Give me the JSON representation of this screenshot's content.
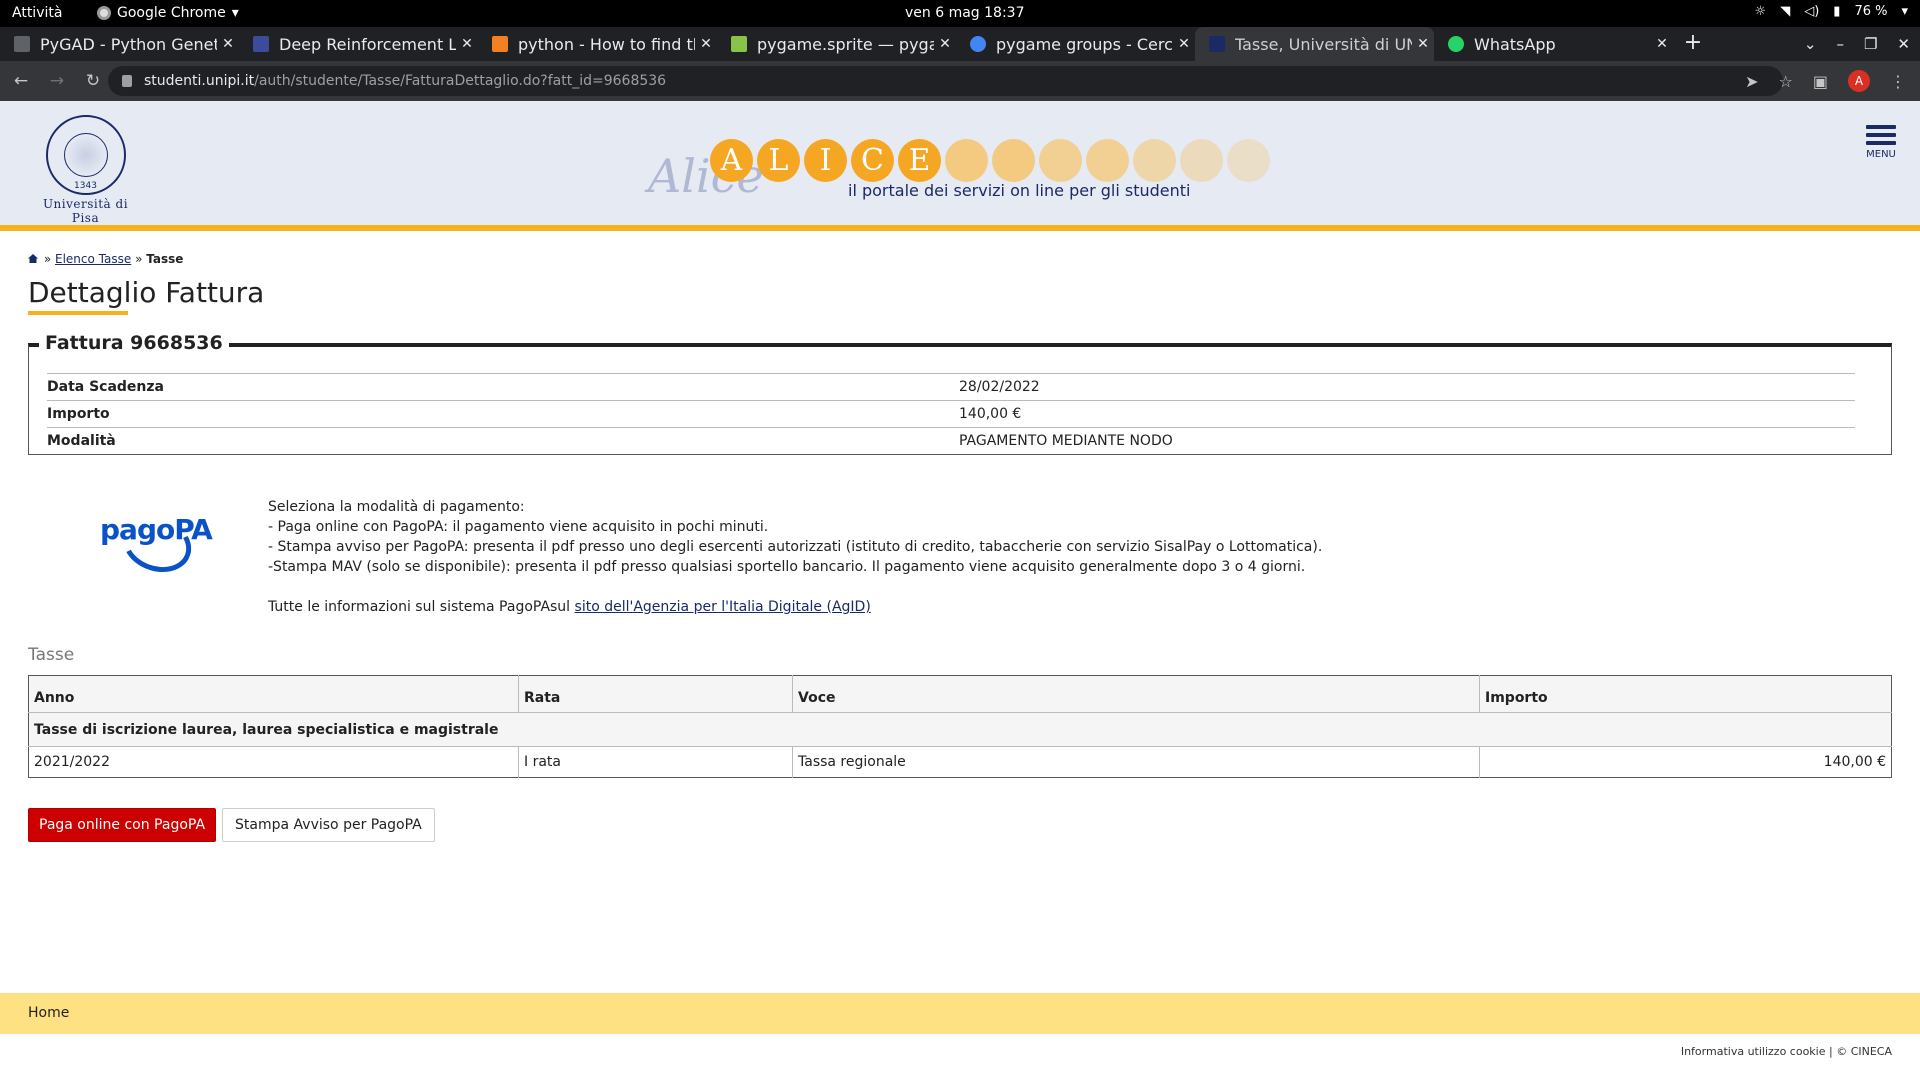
{
  "os_bar": {
    "activities": "Attività",
    "app_name": "Google Chrome",
    "clock": "ven 6 mag  18:37",
    "battery": "76 %"
  },
  "tabs": [
    {
      "title": "PyGAD - Python Genetic",
      "active": false,
      "fav_color": "#5f6368"
    },
    {
      "title": "Deep Reinforcement Le",
      "active": false,
      "fav_color": "#3c4b9a"
    },
    {
      "title": "python - How to find the",
      "active": false,
      "fav_color": "#f48024"
    },
    {
      "title": "pygame.sprite — pygam",
      "active": false,
      "fav_color": "#8bc34a"
    },
    {
      "title": "pygame groups - Cerca c",
      "active": false,
      "fav_color": "#4285f4"
    },
    {
      "title": "Tasse, Università di UNIP",
      "active": true,
      "fav_color": "#1a2a66"
    },
    {
      "title": "WhatsApp",
      "active": false,
      "fav_color": "#25d366"
    }
  ],
  "address": {
    "host": "studenti.unipi.it",
    "path": "/auth/studente/Tasse/FatturaDettaglio.do?fatt_id=9668536",
    "profile_initial": "A"
  },
  "header": {
    "university_name": "Università di Pisa",
    "seal_year": "1343",
    "alice_script": "Alice",
    "alice_letters": [
      "A",
      "L",
      "I",
      "C",
      "E"
    ],
    "tagline": "il portale dei servizi on line per gli studenti",
    "menu_label": "MENU"
  },
  "breadcrumb": {
    "sep": "»",
    "link": "Elenco Tasse",
    "current": "Tasse"
  },
  "page_title": "Dettaglio Fattura",
  "fattura": {
    "legend": "Fattura 9668536",
    "rows": [
      {
        "label": "Data Scadenza",
        "value": "28/02/2022"
      },
      {
        "label": "Importo",
        "value": "140,00 €"
      },
      {
        "label": "Modalità",
        "value": "PAGAMENTO MEDIANTE NODO"
      }
    ]
  },
  "pagopa": {
    "logo_text": "pagoPA",
    "lines": [
      "Seleziona la modalità di pagamento:",
      "- Paga online con PagoPA: il pagamento viene acquisito in pochi minuti.",
      "- Stampa avviso per PagoPA: presenta il pdf presso uno degli esercenti autorizzati (istituto di credito, tabaccherie con servizio SisalPay o Lottomatica).",
      "-Stampa MAV (solo se disponibile): presenta il pdf presso qualsiasi sportello bancario. Il pagamento viene acquisito generalmente dopo 3 o 4 giorni."
    ],
    "info_prefix": "Tutte le informazioni sul sistema PagoPAsul ",
    "info_link": "sito dell'Agenzia per l'Italia Digitale (AgID)"
  },
  "tasse": {
    "label": "Tasse",
    "columns": [
      "Anno",
      "Rata",
      "Voce",
      "Importo"
    ],
    "group": "Tasse di iscrizione laurea, laurea specialistica e magistrale",
    "rows": [
      {
        "anno": "2021/2022",
        "rata": "I rata",
        "voce": "Tassa regionale",
        "importo": "140,00 €"
      }
    ]
  },
  "actions": {
    "pay_online": "Paga online con PagoPA",
    "print_notice": "Stampa Avviso per PagoPA"
  },
  "footer": {
    "home": "Home",
    "bottom": "Informativa utilizzo cookie | © CINECA"
  }
}
